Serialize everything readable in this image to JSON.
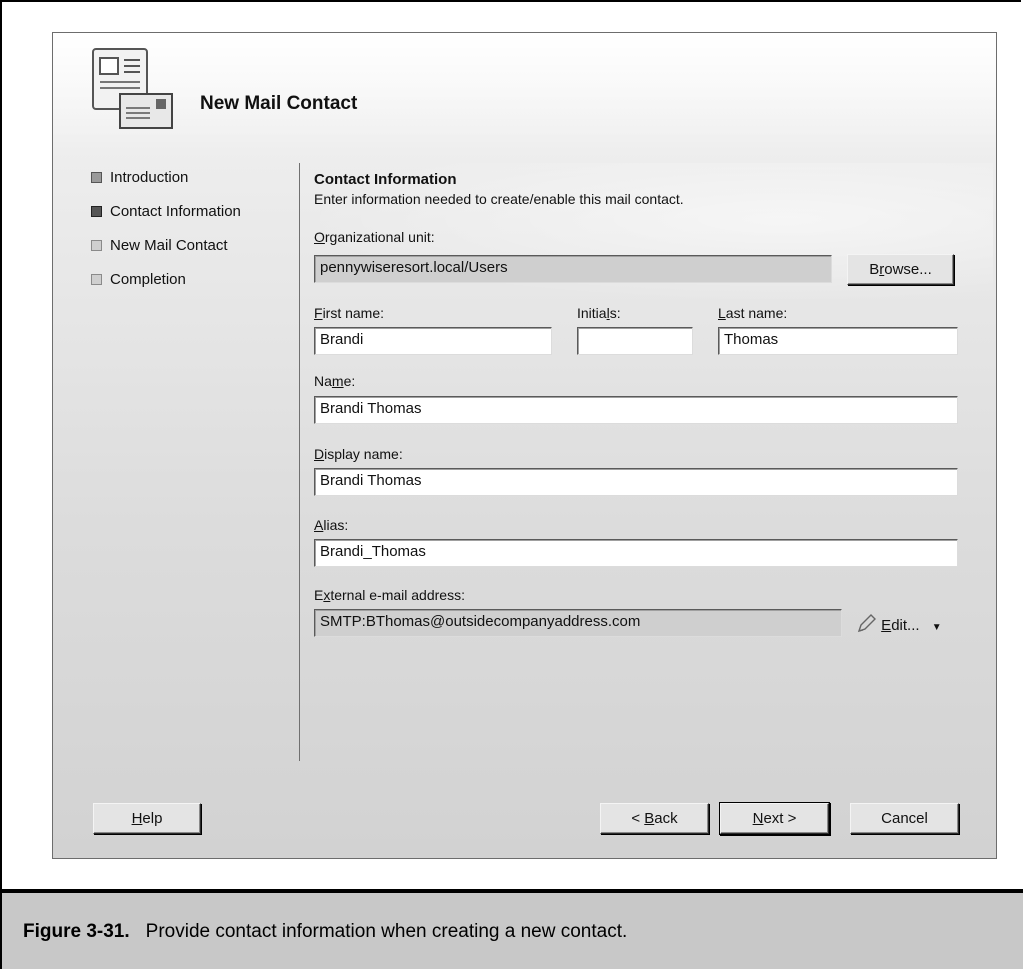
{
  "wizard": {
    "title": "New Mail Contact",
    "steps": [
      {
        "label": "Introduction",
        "state": "done"
      },
      {
        "label": "Contact Information",
        "state": "current"
      },
      {
        "label": "New Mail Contact",
        "state": "pending"
      },
      {
        "label": "Completion",
        "state": "pending"
      }
    ]
  },
  "section": {
    "title": "Contact Information",
    "description": "Enter information needed to create/enable this mail contact."
  },
  "form": {
    "ou_label": {
      "accel": "O",
      "rest": "rganizational unit:"
    },
    "ou_value": "pennywiseresort.local/Users",
    "browse_label": {
      "pre": "B",
      "accel": "r",
      "rest": "owse..."
    },
    "first_label": {
      "accel": "F",
      "rest": "irst name:"
    },
    "first_value": "Brandi",
    "initials_label": {
      "pre": "Initia",
      "accel": "l",
      "rest": "s:"
    },
    "initials_value": "",
    "last_label": {
      "accel": "L",
      "rest": "ast name:"
    },
    "last_value": "Thomas",
    "name_label": {
      "pre": "Na",
      "accel": "m",
      "rest": "e:"
    },
    "name_value": "Brandi Thomas",
    "display_label": {
      "accel": "D",
      "rest": "isplay name:"
    },
    "display_value": "Brandi Thomas",
    "alias_label": {
      "accel": "A",
      "rest": "lias:"
    },
    "alias_value": "Brandi_Thomas",
    "email_label": {
      "pre": "E",
      "accel": "x",
      "rest": "ternal e-mail address:"
    },
    "email_value": "SMTP:BThomas@outsidecompanyaddress.com",
    "edit_label": {
      "accel": "E",
      "rest": "dit..."
    }
  },
  "buttons": {
    "help": {
      "accel": "H",
      "rest": "elp"
    },
    "back": {
      "pre": "< ",
      "accel": "B",
      "rest": "ack"
    },
    "next": {
      "accel": "N",
      "rest": "ext >"
    },
    "cancel": "Cancel"
  },
  "caption": {
    "number": "Figure 3-31.",
    "text": "Provide contact information when creating a new contact."
  }
}
